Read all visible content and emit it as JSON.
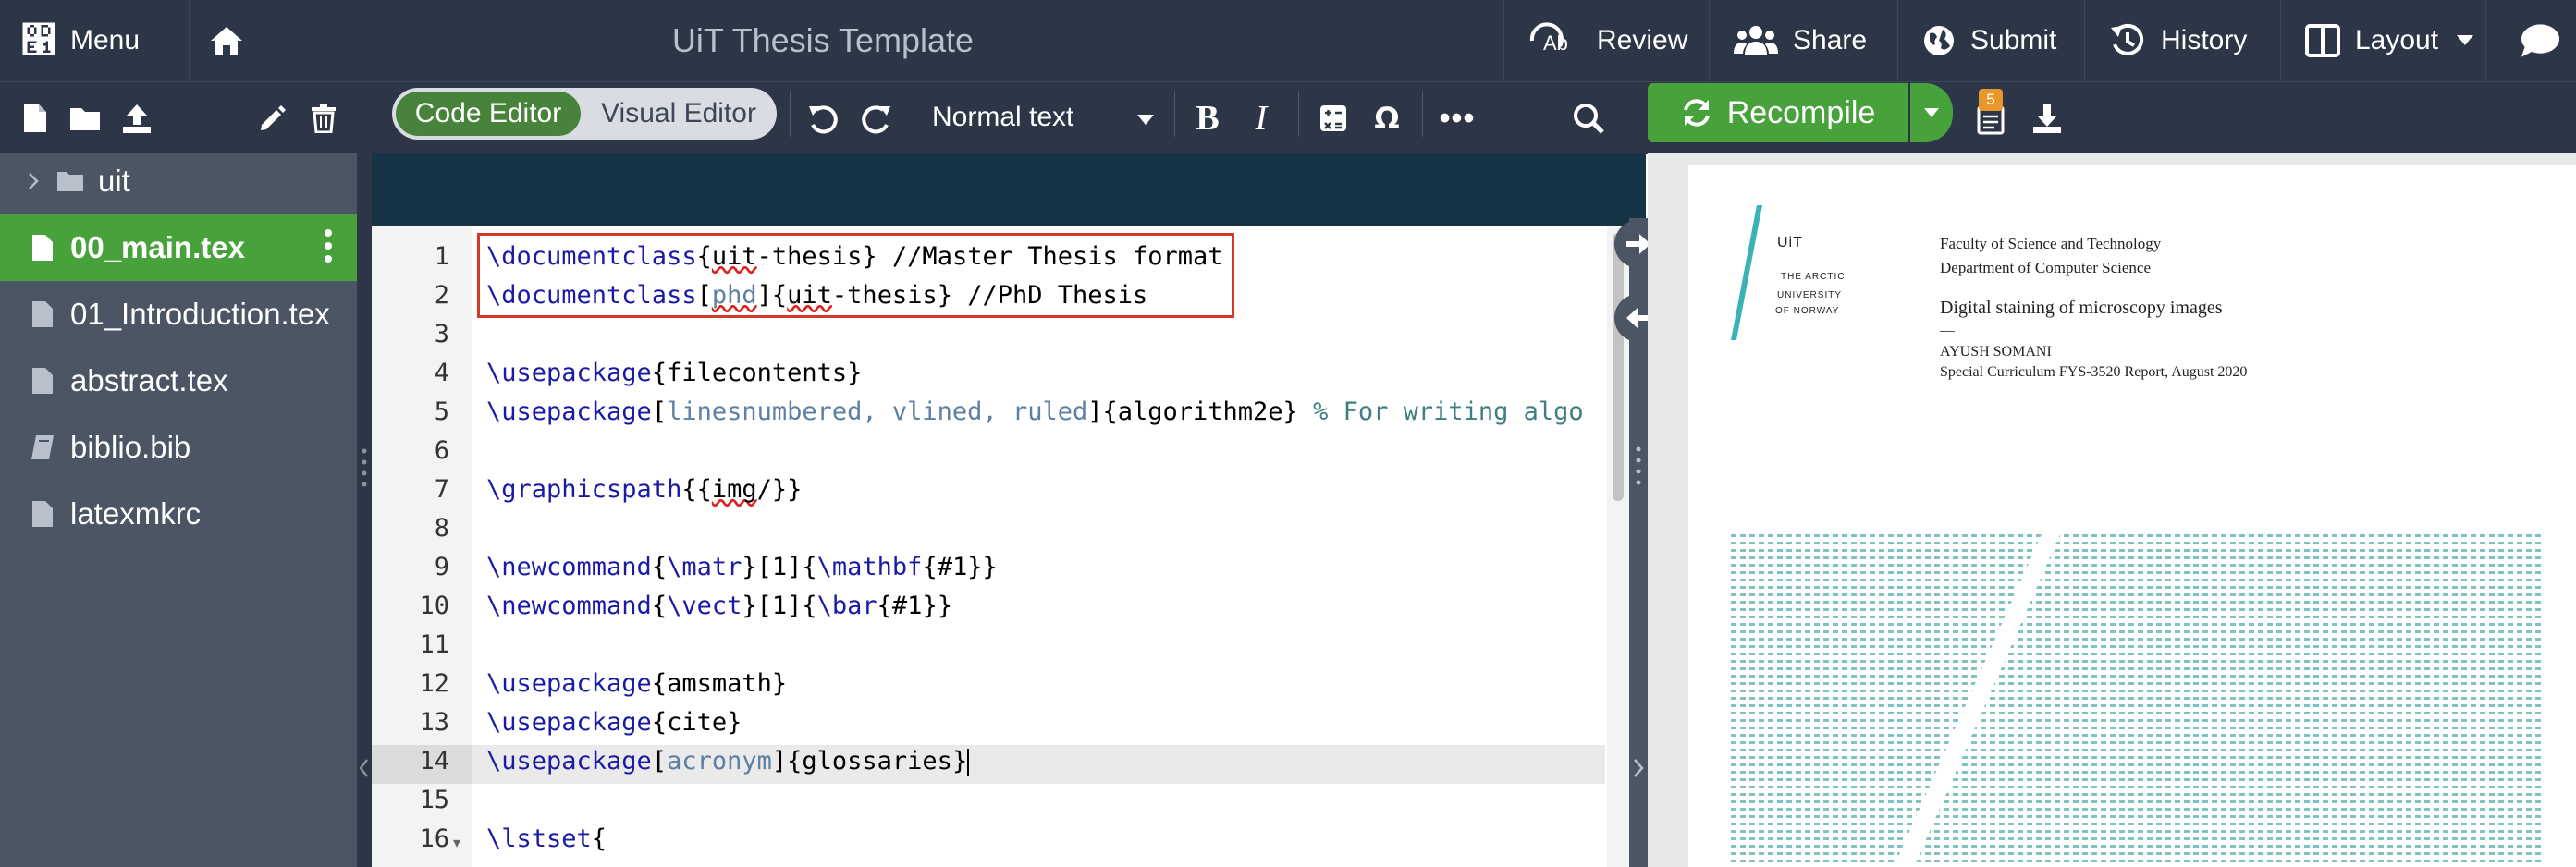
{
  "header": {
    "menu_label": "Menu",
    "title": "UiT Thesis Template",
    "buttons": {
      "review": "Review",
      "share": "Share",
      "submit": "Submit",
      "history": "History",
      "layout": "Layout"
    }
  },
  "toolbar": {
    "code_editor": "Code Editor",
    "visual_editor": "Visual Editor",
    "text_style": "Normal text",
    "recompile": "Recompile",
    "logs_badge": "5"
  },
  "file_tree": {
    "items": [
      {
        "label": "uit",
        "type": "folder"
      },
      {
        "label": "00_main.tex",
        "type": "file",
        "selected": true
      },
      {
        "label": "01_Introduction.tex",
        "type": "file"
      },
      {
        "label": "abstract.tex",
        "type": "file"
      },
      {
        "label": "biblio.bib",
        "type": "bib"
      },
      {
        "label": "latexmkrc",
        "type": "file"
      }
    ]
  },
  "editor": {
    "line_numbers": [
      "1",
      "2",
      "3",
      "4",
      "5",
      "6",
      "7",
      "8",
      "9",
      "10",
      "11",
      "12",
      "13",
      "14",
      "15",
      "16"
    ],
    "active_line": "14",
    "lines": {
      "l1": {
        "cmd": "\\documentclass",
        "a": "{",
        "b": "uit",
        "c": "-thesis} //Master Thesis format"
      },
      "l2": {
        "cmd": "\\documentclass",
        "a": "[",
        "b": "phd",
        "c": "]{",
        "d": "uit",
        "e": "-thesis} //PhD Thesis"
      },
      "l4": {
        "cmd": "\\usepackage",
        "rest": "{filecontents}"
      },
      "l5": {
        "cmd": "\\usepackage",
        "a": "[",
        "opts": "linesnumbered, vlined, ruled",
        "b": "]{algorithm2e} ",
        "comment": "% For writing algo"
      },
      "l7": {
        "cmd": "\\graphicspath",
        "a": "{{",
        "b": "img",
        "c": "/}}"
      },
      "l9": {
        "cmd": "\\newcommand",
        "a": "{",
        "cmd2": "\\matr",
        "b": "}[1]{",
        "cmd3": "\\mathbf",
        "c": "{#1}}"
      },
      "l10": {
        "cmd": "\\newcommand",
        "a": "{",
        "cmd2": "\\vect",
        "b": "}[1]{",
        "cmd3": "\\bar",
        "c": "{#1}}"
      },
      "l12": {
        "cmd": "\\usepackage",
        "rest": "{amsmath}"
      },
      "l13": {
        "cmd": "\\usepackage",
        "rest": "{cite}"
      },
      "l14": {
        "cmd": "\\usepackage",
        "a": "[",
        "opts": "acronym",
        "b": "]{glossaries}"
      },
      "l16": {
        "cmd": "\\lstset",
        "rest": "{"
      }
    }
  },
  "pdf": {
    "logo_name": "UiT",
    "logo_sub": [
      "THE ARCTIC",
      "UNIVERSITY",
      "OF NORWAY"
    ],
    "faculty": "Faculty of Science and Technology",
    "department": "Department of Computer Science",
    "thesis_title": "Digital staining of microscopy images",
    "author": "AYUSH SOMANI",
    "report": "Special Curriculum FYS-3520 Report, August 2020"
  },
  "colors": {
    "accent_green": "#48a23b",
    "header_bg": "#2c3646",
    "tree_bg": "#4b5563",
    "highlight_red": "#d7382a"
  }
}
